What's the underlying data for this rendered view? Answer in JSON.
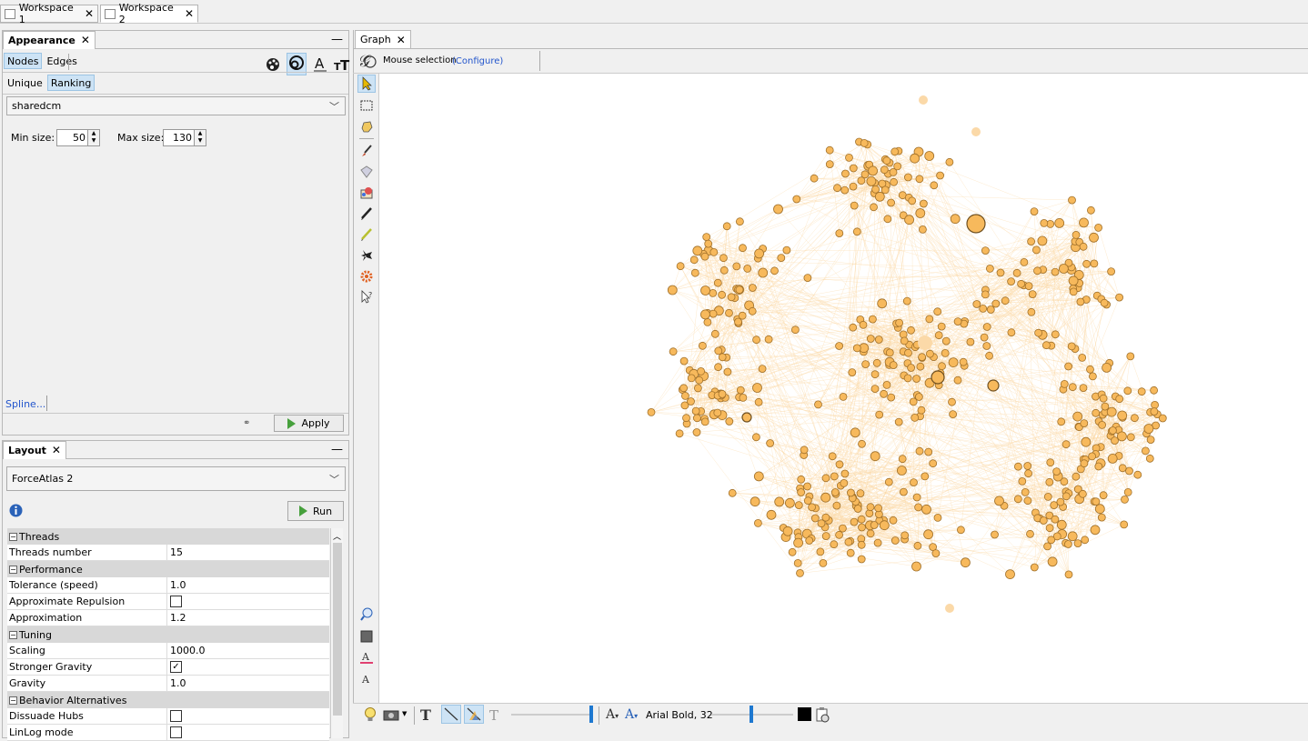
{
  "workspaces": [
    {
      "label": "Workspace 1"
    },
    {
      "label": "Workspace 2"
    }
  ],
  "appearance": {
    "tab_title": "Appearance",
    "subtabs": [
      "Nodes",
      "Edges"
    ],
    "modes": [
      "Unique",
      "Ranking"
    ],
    "attribute": "sharedcm",
    "min_label": "Min size:",
    "min_value": "50",
    "max_label": "Max size:",
    "max_value": "130",
    "spline_label": "Spline...",
    "apply_label": "Apply"
  },
  "layout": {
    "tab_title": "Layout",
    "algorithm": "ForceAtlas 2",
    "run_label": "Run",
    "categories": [
      {
        "name": "Threads",
        "props": [
          {
            "key": "Threads number",
            "value": "15",
            "type": "text"
          }
        ]
      },
      {
        "name": "Performance",
        "props": [
          {
            "key": "Tolerance (speed)",
            "value": "1.0",
            "type": "text"
          },
          {
            "key": "Approximate Repulsion",
            "checked": false,
            "type": "check"
          },
          {
            "key": "Approximation",
            "value": "1.2",
            "type": "text"
          }
        ]
      },
      {
        "name": "Tuning",
        "props": [
          {
            "key": "Scaling",
            "value": "1000.0",
            "type": "text"
          },
          {
            "key": "Stronger Gravity",
            "checked": true,
            "type": "check"
          },
          {
            "key": "Gravity",
            "value": "1.0",
            "type": "text"
          }
        ]
      },
      {
        "name": "Behavior Alternatives",
        "props": [
          {
            "key": "Dissuade Hubs",
            "checked": false,
            "type": "check"
          },
          {
            "key": "LinLog mode",
            "checked": false,
            "type": "check"
          }
        ]
      }
    ]
  },
  "graph": {
    "tab_title": "Graph",
    "selection_label": "Mouse selection",
    "configure_link": "(Configure)",
    "font_label": "Arial Bold, 32",
    "node_color": "#f7b95c",
    "edge_color": "#fcd9a6"
  }
}
